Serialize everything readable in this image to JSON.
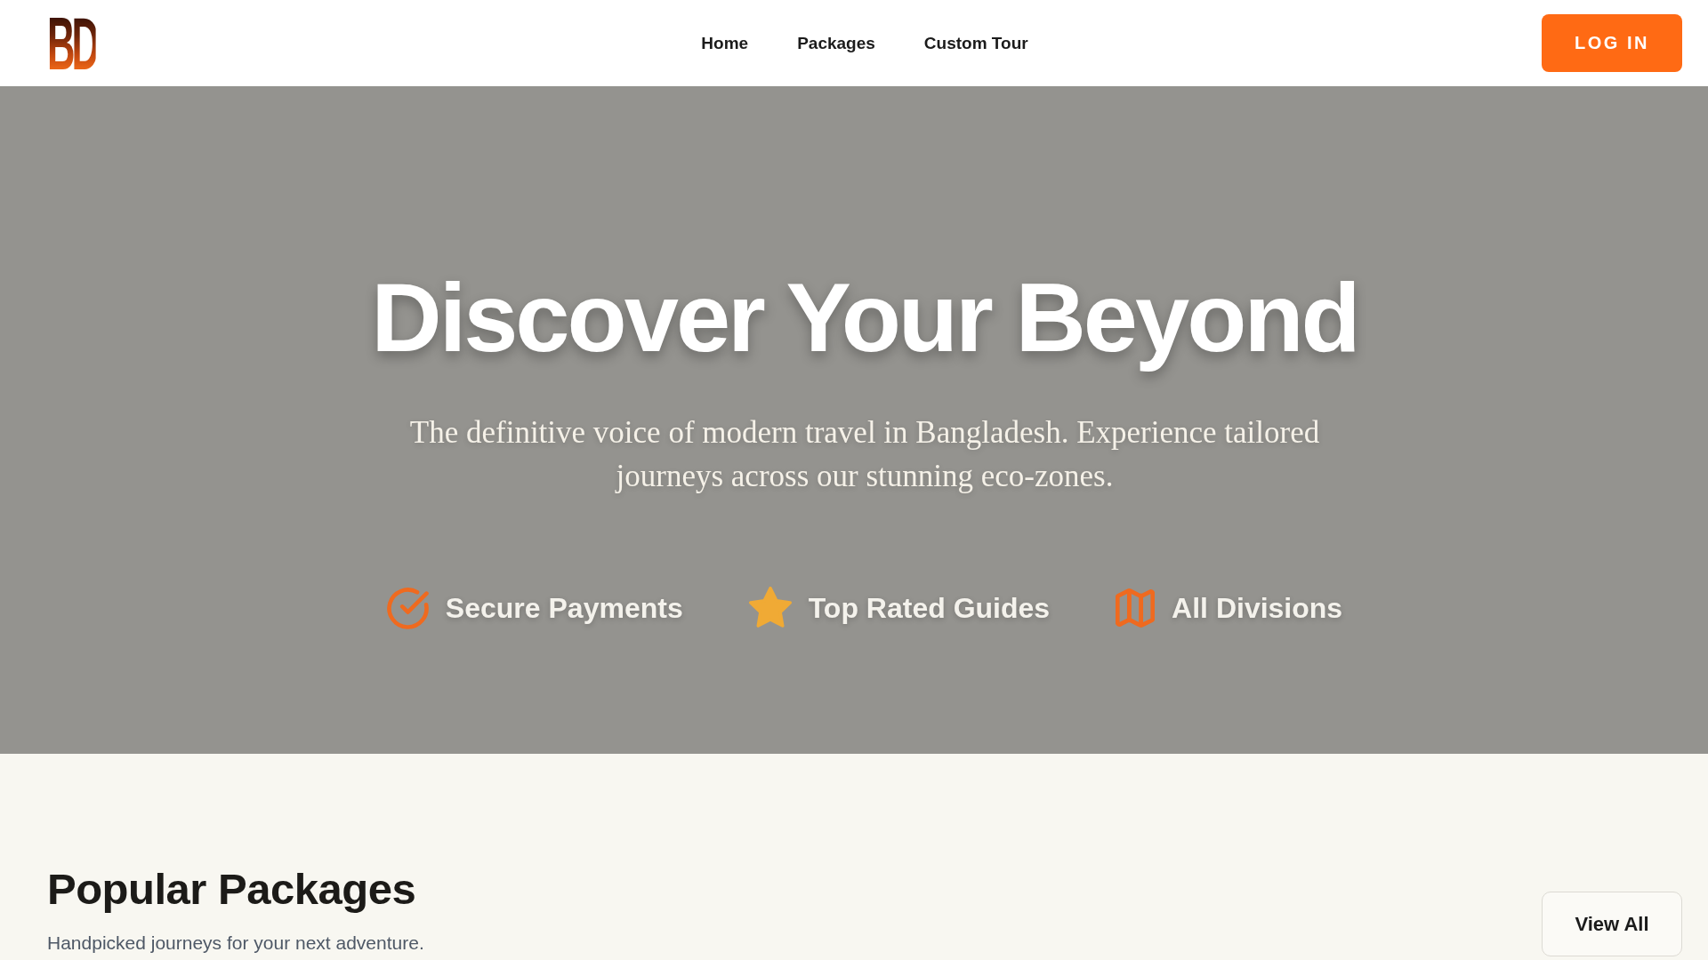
{
  "header": {
    "logo": "BD",
    "nav": [
      {
        "label": "Home"
      },
      {
        "label": "Packages"
      },
      {
        "label": "Custom Tour"
      }
    ],
    "login_button": "LOG IN"
  },
  "hero": {
    "title": "Discover Your Beyond",
    "subtitle": "The definitive voice of modern travel in Bangladesh. Experience tailored journeys across our stunning eco-zones.",
    "features": [
      {
        "kind": "check",
        "label": "Secure Payments"
      },
      {
        "kind": "star",
        "label": "Top Rated Guides"
      },
      {
        "kind": "map",
        "label": "All Divisions"
      }
    ]
  },
  "popular_packages": {
    "title": "Popular Packages",
    "subtitle": "Handpicked journeys for your next adventure.",
    "view_all_button": "View All"
  }
}
